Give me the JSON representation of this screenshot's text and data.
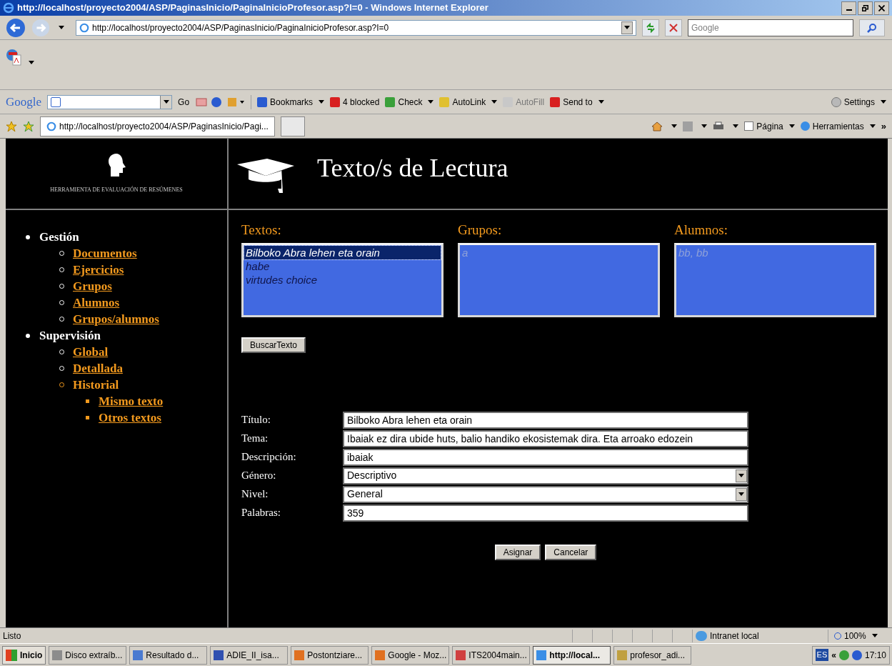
{
  "window": {
    "title": "http://localhost/proyecto2004/ASP/PaginasInicio/PaginaInicioProfesor.asp?I=0 - Windows Internet Explorer"
  },
  "address_bar": {
    "value": "http://localhost/proyecto2004/ASP/PaginasInicio/PaginaInicioProfesor.asp?I=0"
  },
  "search_field": {
    "placeholder": "Google"
  },
  "google_toolbar": {
    "logo": "Google",
    "go": "Go",
    "items": [
      {
        "label": "Bookmarks",
        "kind": "dropdown",
        "disabled": false
      },
      {
        "label": "4 blocked",
        "kind": "plain",
        "disabled": false
      },
      {
        "label": "Check",
        "kind": "dropdown",
        "disabled": false
      },
      {
        "label": "AutoLink",
        "kind": "dropdown",
        "disabled": false
      },
      {
        "label": "AutoFill",
        "kind": "plain",
        "disabled": true
      },
      {
        "label": "Send to",
        "kind": "dropdown",
        "disabled": false
      }
    ],
    "settings": "Settings"
  },
  "tabs": [
    {
      "label": "http://localhost/proyecto2004/ASP/PaginasInicio/Pagi...",
      "selected": true
    }
  ],
  "command_bar": {
    "items": [
      "Página",
      "Herramientas"
    ],
    "more": "»"
  },
  "page": {
    "logo_caption": "HERRAMIENTA DE EVALUACIÓN DE RESÚMENES",
    "heading": "Texto/s de Lectura",
    "nav": [
      {
        "label": "Gestión",
        "link": false,
        "children": [
          {
            "label": "Documentos",
            "link": true
          },
          {
            "label": "Ejercicios",
            "link": true
          },
          {
            "label": "Grupos",
            "link": true
          },
          {
            "label": "Alumnos",
            "link": true
          },
          {
            "label": "Grupos/alumnos",
            "link": true
          }
        ]
      },
      {
        "label": "Supervisión",
        "link": false,
        "children": [
          {
            "label": "Global",
            "link": true
          },
          {
            "label": "Detallada",
            "link": true
          },
          {
            "label": "Historial",
            "link": false,
            "children": [
              {
                "label": "Mismo texto",
                "link": true
              },
              {
                "label": "Otros textos",
                "link": true
              }
            ]
          }
        ]
      }
    ],
    "lists": [
      {
        "label": "Textos:",
        "disabled": false,
        "items": [
          {
            "text": "Bilboko Abra lehen eta orain",
            "selected": true
          },
          {
            "text": "habe",
            "selected": false
          },
          {
            "text": "virtudes choice",
            "selected": false
          }
        ]
      },
      {
        "label": "Grupos:",
        "disabled": true,
        "items": [
          {
            "text": "a",
            "selected": false
          }
        ]
      },
      {
        "label": "Alumnos:",
        "disabled": true,
        "items": [
          {
            "text": "bb, bb",
            "selected": false
          }
        ]
      }
    ],
    "search_button": "BuscarTexto",
    "form": [
      {
        "label": "Título:",
        "kind": "text",
        "value": "Bilboko Abra lehen eta orain"
      },
      {
        "label": "Tema:",
        "kind": "text",
        "value": "Ibaiak ez dira ubide huts, balio handiko ekosistemak dira. Eta arroako edozein"
      },
      {
        "label": "Descripción:",
        "kind": "text",
        "value": "ibaiak"
      },
      {
        "label": "Género:",
        "kind": "select",
        "value": "Descriptivo"
      },
      {
        "label": "Nivel:",
        "kind": "select",
        "value": "General"
      },
      {
        "label": "Palabras:",
        "kind": "text",
        "value": "359"
      }
    ],
    "buttons": [
      "Asignar",
      "Cancelar"
    ]
  },
  "status_bar": {
    "text": "Listo",
    "zone": "Intranet local",
    "zoom": "100%"
  },
  "taskbar": {
    "start": "Inicio",
    "tasks": [
      {
        "label": "Disco extraíb...",
        "selected": false
      },
      {
        "label": "Resultado d...",
        "selected": false
      },
      {
        "label": "ADIE_II_isa...",
        "selected": false
      },
      {
        "label": "Postontziare...",
        "selected": false
      },
      {
        "label": "Google - Moz...",
        "selected": false
      },
      {
        "label": "ITS2004main...",
        "selected": false
      },
      {
        "label": "http://local...",
        "selected": true
      },
      {
        "label": "profesor_adi...",
        "selected": false
      }
    ],
    "lang": "ES",
    "chevron": "«",
    "clock": "17:10"
  }
}
